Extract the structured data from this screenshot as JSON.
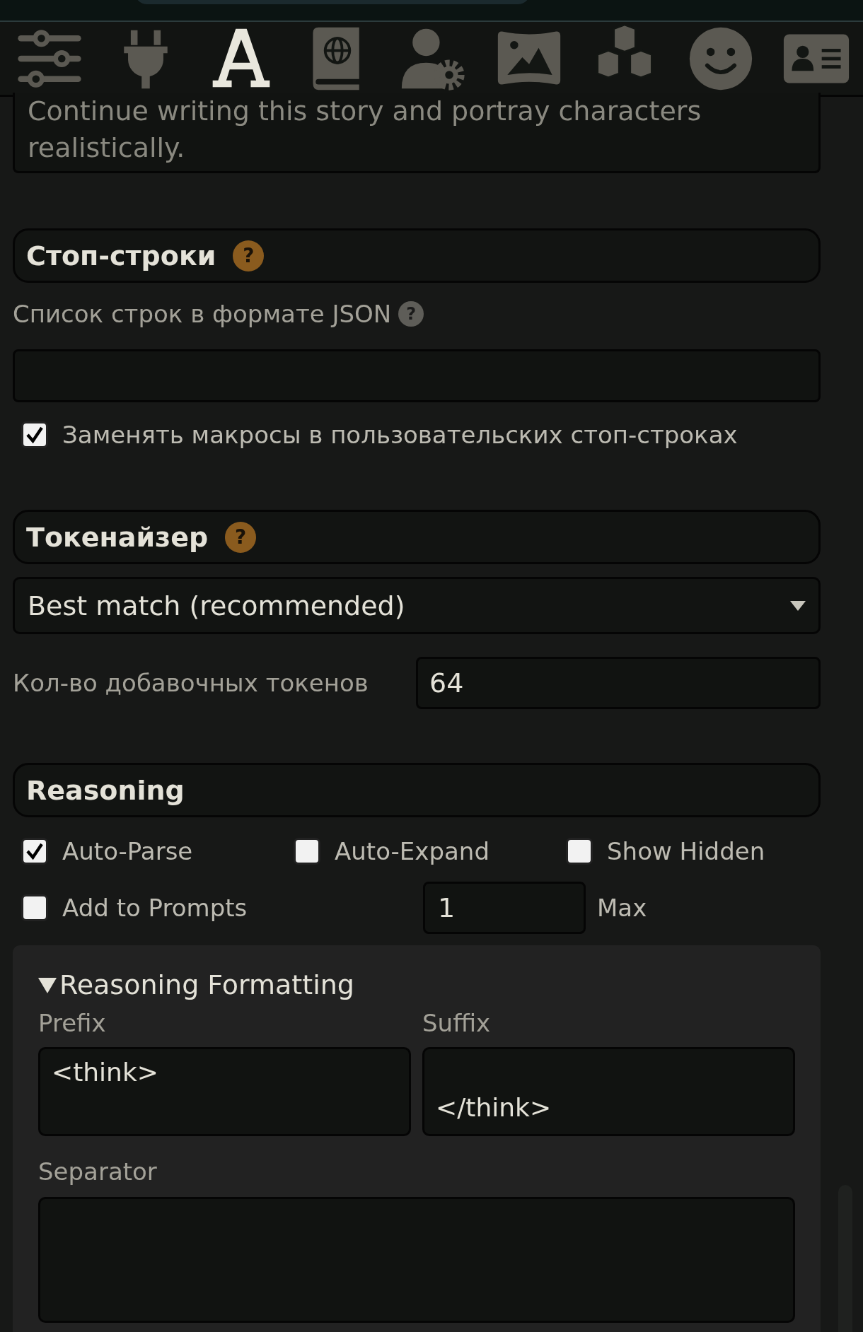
{
  "toolbar": {
    "icons": [
      {
        "kind": "sliders",
        "selected": false
      },
      {
        "kind": "plug",
        "selected": false
      },
      {
        "kind": "font",
        "selected": true
      },
      {
        "kind": "book-globe",
        "selected": false
      },
      {
        "kind": "user-gear",
        "selected": false
      },
      {
        "kind": "image",
        "selected": false
      },
      {
        "kind": "cubes",
        "selected": false
      },
      {
        "kind": "smiley",
        "selected": false
      },
      {
        "kind": "id-card",
        "selected": false
      }
    ]
  },
  "prompt_field": {
    "value": "Continue writing this story and portray characters realistically."
  },
  "stop_strings": {
    "title": "Стоп-строки",
    "help": "?",
    "list_label": "Список строк в формате JSON",
    "list_help": "?",
    "replace_macros": {
      "label": "Заменять макросы в пользовательских стоп-строках",
      "checked": true
    }
  },
  "tokenizer": {
    "title": "Токенайзер",
    "help": "?",
    "select": {
      "value": "Best match (recommended)"
    },
    "padding": {
      "label": "Кол-во добавочных токенов",
      "value": "64"
    }
  },
  "reasoning": {
    "title": "Reasoning",
    "options": [
      {
        "label": "Auto-Parse",
        "checked": true
      },
      {
        "label": "Auto-Expand",
        "checked": false
      },
      {
        "label": "Show Hidden",
        "checked": false
      }
    ],
    "add_to_prompts": {
      "label": "Add to Prompts",
      "checked": false
    },
    "max_additions": {
      "value": "1",
      "unit": "Max"
    },
    "formatting": {
      "title": "Reasoning Formatting",
      "expanded": true,
      "prefix": {
        "label": "Prefix",
        "value": "<think>"
      },
      "suffix": {
        "label": "Suffix",
        "value": "\n</think>"
      },
      "separator": {
        "label": "Separator"
      }
    }
  }
}
